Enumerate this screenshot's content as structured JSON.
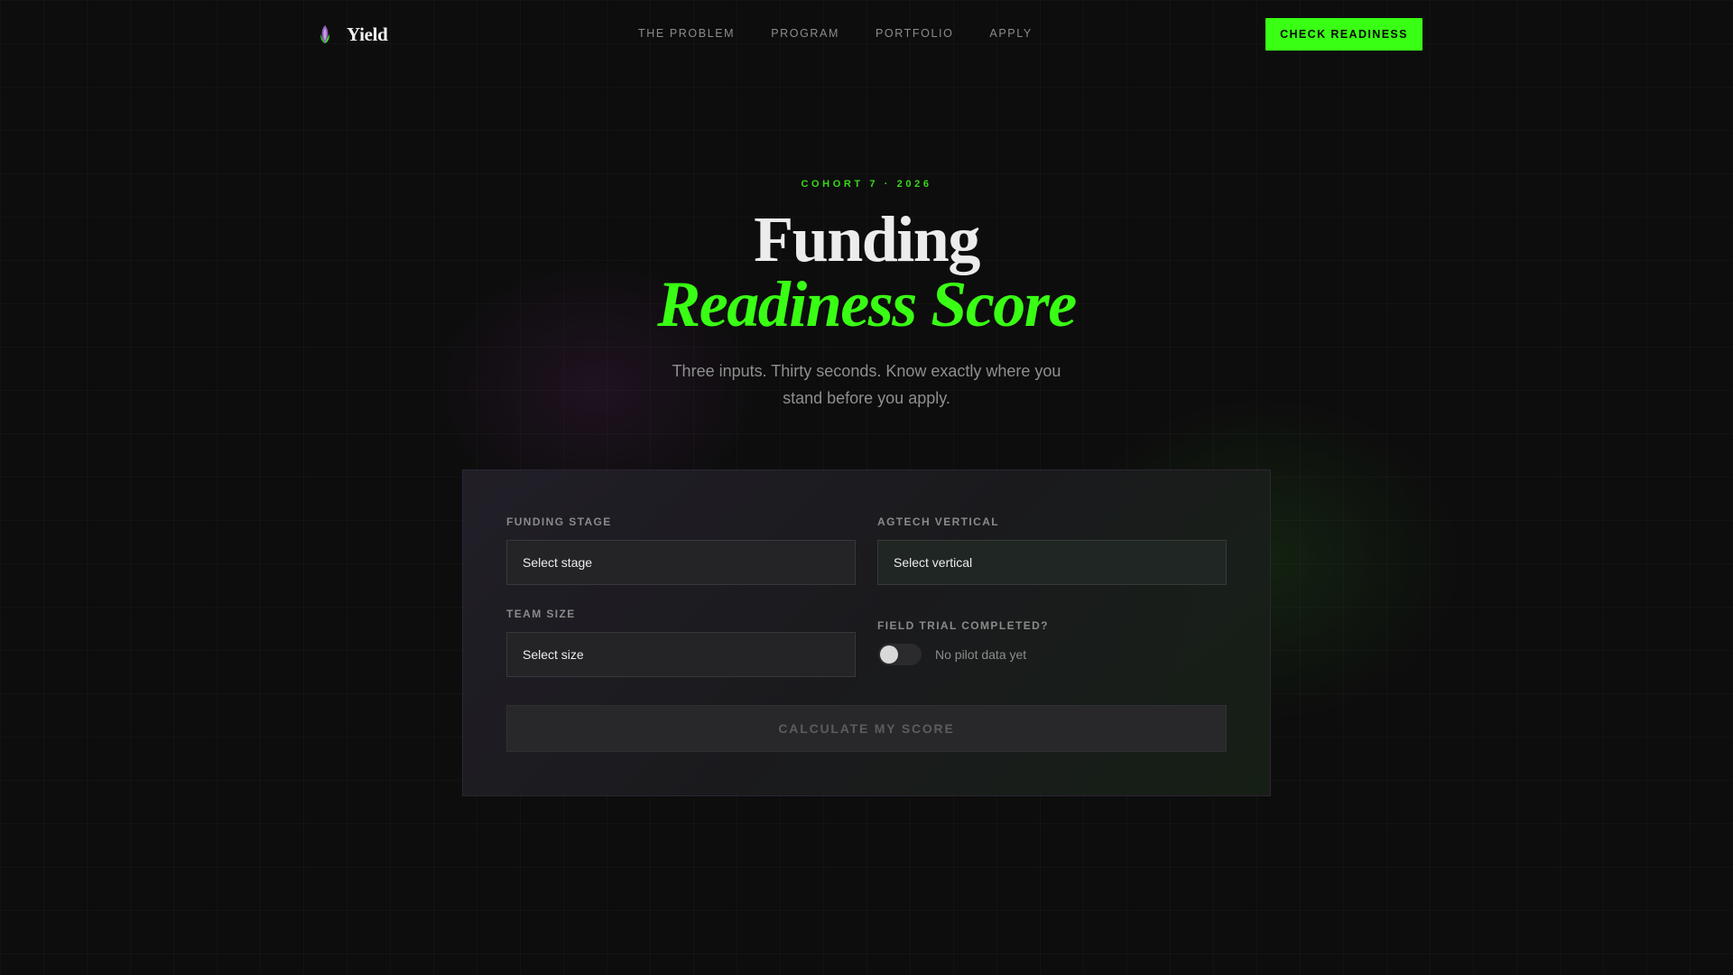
{
  "brand": {
    "name": "Yield",
    "icon": "corn-icon"
  },
  "nav": {
    "links": [
      "THE PROBLEM",
      "PROGRAM",
      "PORTFOLIO",
      "APPLY"
    ],
    "cta_label": "CHECK READINESS"
  },
  "hero": {
    "eyebrow": "COHORT 7 · 2026",
    "title_line1": "Funding",
    "title_line2": "Readiness Score",
    "subtitle": "Three inputs. Thirty seconds. Know exactly where you stand before you apply."
  },
  "form": {
    "funding_stage": {
      "label": "FUNDING STAGE",
      "value": "Select stage"
    },
    "agtech_vertical": {
      "label": "AGTECH VERTICAL",
      "value": "Select vertical"
    },
    "team_size": {
      "label": "TEAM SIZE",
      "value": "Select size"
    },
    "field_trial": {
      "label": "FIELD TRIAL COMPLETED?",
      "toggle_text": "No pilot data yet",
      "checked": false
    },
    "submit_label": "CALCULATE MY SCORE"
  },
  "colors": {
    "accent": "#39ff14",
    "background": "#0d0d0d",
    "muted_text": "#8c8c8c"
  }
}
